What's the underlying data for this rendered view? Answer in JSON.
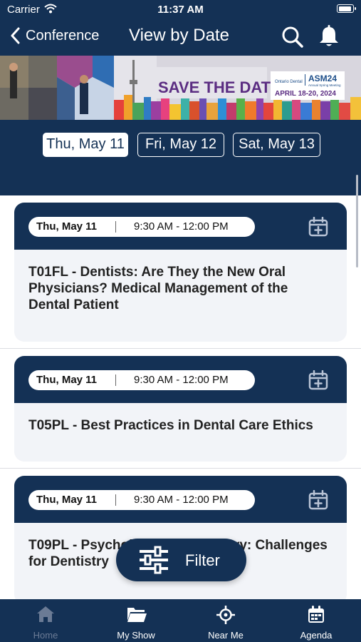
{
  "status": {
    "carrier": "Carrier",
    "time": "11:37 AM"
  },
  "header": {
    "back_label": "Conference",
    "title": "View by Date"
  },
  "banner": {
    "headline": "SAVE THE DATES",
    "brand": "Ontario Dental",
    "event": "ASM24",
    "event_sub": "Annual Spring Meeting",
    "dates": "APRIL 18-20, 2024"
  },
  "date_tabs": [
    {
      "label": "Thu, May 11",
      "selected": true
    },
    {
      "label": "Fri, May 12",
      "selected": false
    },
    {
      "label": "Sat, May 13",
      "selected": false
    }
  ],
  "sessions": [
    {
      "date": "Thu, May 11",
      "time": "9:30 AM - 12:00 PM",
      "title": "T01FL - Dentists: Are They the New Oral Physicians? Medical Management of the Dental Patient"
    },
    {
      "date": "Thu, May 11",
      "time": "9:30 AM - 12:00 PM",
      "title": "T05PL - Best Practices in Dental Care Ethics"
    },
    {
      "date": "Thu, May 11",
      "time": "9:30 AM - 12:00 PM",
      "title": "T09PL - Psychology and Dentistry: Challenges for Dentistry"
    }
  ],
  "filter": {
    "label": "Filter"
  },
  "tabbar": [
    {
      "label": "Home",
      "icon": "home-icon",
      "active": false
    },
    {
      "label": "My Show",
      "icon": "folder-icon",
      "active": true
    },
    {
      "label": "Near Me",
      "icon": "location-icon",
      "active": true
    },
    {
      "label": "Agenda",
      "icon": "calendar-icon",
      "active": true
    }
  ],
  "colors": {
    "navy": "#143155",
    "card_bg": "#f2f4f8",
    "banner_purple": "#5b2d82"
  }
}
